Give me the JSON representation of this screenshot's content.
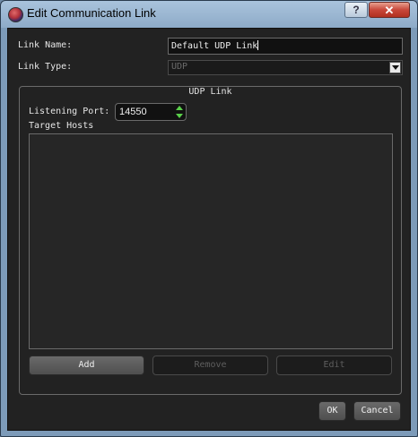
{
  "window": {
    "title": "Edit Communication Link",
    "help_label": "?",
    "close_label": "✕"
  },
  "form": {
    "link_name_label": "Link Name:",
    "link_name_value": "Default UDP Link",
    "link_type_label": "Link Type:",
    "link_type_value": "UDP"
  },
  "udp_group": {
    "title": "UDP Link",
    "listening_port_label": "Listening Port:",
    "listening_port_value": "14550",
    "target_hosts_label": "Target Hosts",
    "target_hosts": [],
    "add_label": "Add",
    "remove_label": "Remove",
    "edit_label": "Edit"
  },
  "footer": {
    "ok_label": "OK",
    "cancel_label": "Cancel"
  },
  "colors": {
    "dialog_background": "#222222",
    "titlebar": "#a9c3dc",
    "spin_arrow": "#5ad04a"
  }
}
